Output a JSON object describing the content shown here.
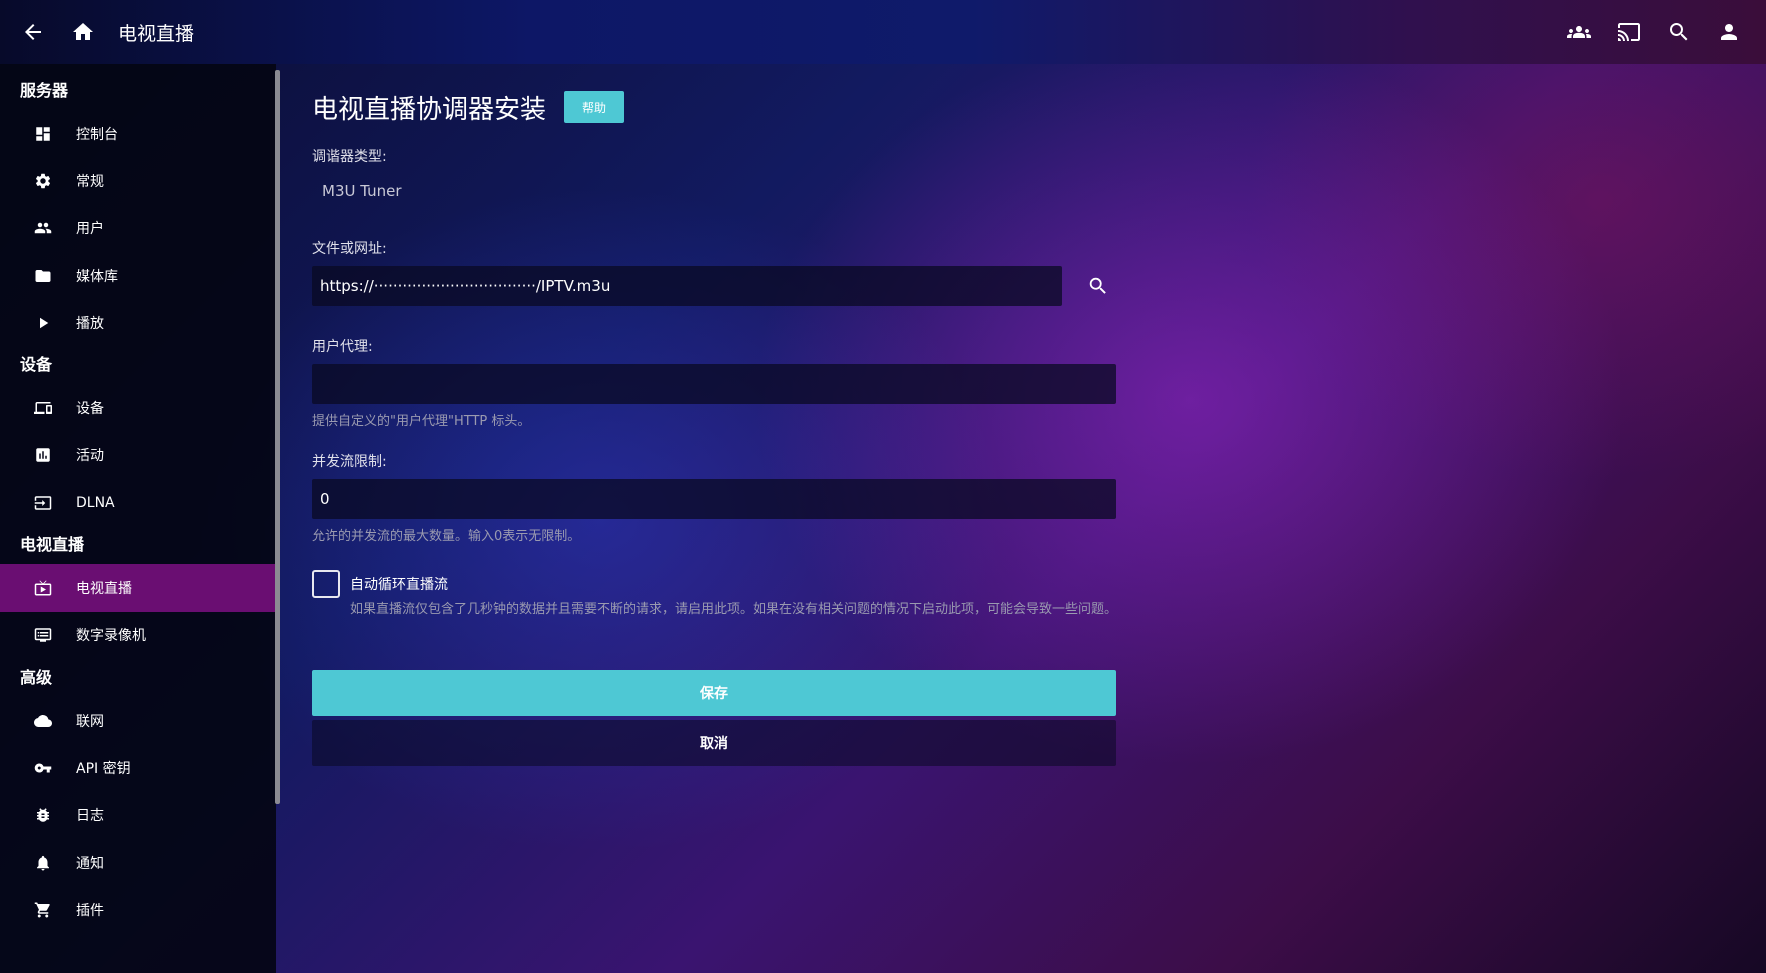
{
  "header": {
    "title": "电视直播",
    "icons": [
      "back-arrow-icon",
      "home-icon",
      "users-icon",
      "cast-icon",
      "search-icon",
      "user-icon"
    ]
  },
  "sidebar": {
    "sections": [
      {
        "title": "服务器",
        "items": [
          {
            "label": "控制台",
            "icon": "dashboard-icon"
          },
          {
            "label": "常规",
            "icon": "settings-gear-icon"
          },
          {
            "label": "用户",
            "icon": "people-icon"
          },
          {
            "label": "媒体库",
            "icon": "folder-icon"
          },
          {
            "label": "播放",
            "icon": "play-icon"
          }
        ]
      },
      {
        "title": "设备",
        "items": [
          {
            "label": "设备",
            "icon": "devices-icon"
          },
          {
            "label": "活动",
            "icon": "chart-icon"
          },
          {
            "label": "DLNA",
            "icon": "input-icon"
          }
        ]
      },
      {
        "title": "电视直播",
        "items": [
          {
            "label": "电视直播",
            "icon": "live-tv-icon"
          },
          {
            "label": "数字录像机",
            "icon": "dvr-icon"
          }
        ]
      },
      {
        "title": "高级",
        "items": [
          {
            "label": "联网",
            "icon": "cloud-icon"
          },
          {
            "label": "API 密钥",
            "icon": "key-icon"
          },
          {
            "label": "日志",
            "icon": "bug-icon"
          },
          {
            "label": "通知",
            "icon": "bell-icon"
          },
          {
            "label": "插件",
            "icon": "cart-icon"
          }
        ]
      }
    ]
  },
  "main": {
    "title": "电视直播协调器安装",
    "help_label": "帮助",
    "tuner_type_label": "调谐器类型:",
    "tuner_type_value": "M3U Tuner",
    "file_url_label": "文件或网址:",
    "file_url_value": "https://··································/IPTV.m3u",
    "user_agent_label": "用户代理:",
    "user_agent_value": "",
    "user_agent_hint": "提供自定义的\"用户代理\"HTTP 标头。",
    "stream_limit_label": "并发流限制:",
    "stream_limit_value": "0",
    "stream_limit_hint": "允许的并发流的最大数量。输入0表示无限制。",
    "auto_loop_label": "自动循环直播流",
    "auto_loop_hint": "如果直播流仅包含了几秒钟的数据并且需要不断的请求，请启用此项。如果在没有相关问题的情况下启动此项，可能会导致一些问题。",
    "save_label": "保存",
    "cancel_label": "取消"
  }
}
